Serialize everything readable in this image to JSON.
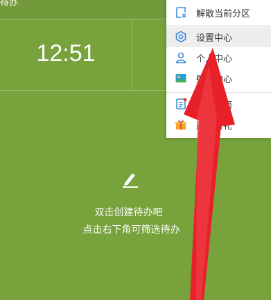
{
  "header": {
    "title": "待办"
  },
  "clock": {
    "time": "12:51"
  },
  "empty_state": {
    "icon": "pencil-icon",
    "line1": "双击创建待办吧",
    "line2": "点击右下角可筛选待办"
  },
  "menu": {
    "items": [
      {
        "label": "解散当前分区",
        "icon": "dissolve-partition-icon"
      },
      {
        "label": "设置中心",
        "icon": "settings-icon"
      },
      {
        "label": "个人中心",
        "icon": "user-icon"
      },
      {
        "label": "壁纸中心",
        "icon": "wallpaper-icon"
      },
      {
        "label": "功能指南",
        "icon": "guide-icon"
      },
      {
        "label": "邀请有礼",
        "icon": "gift-icon"
      }
    ]
  },
  "colors": {
    "background": "#77a23c",
    "accent_blue": "#3d8fd9",
    "arrow_red": "#e8202a"
  }
}
